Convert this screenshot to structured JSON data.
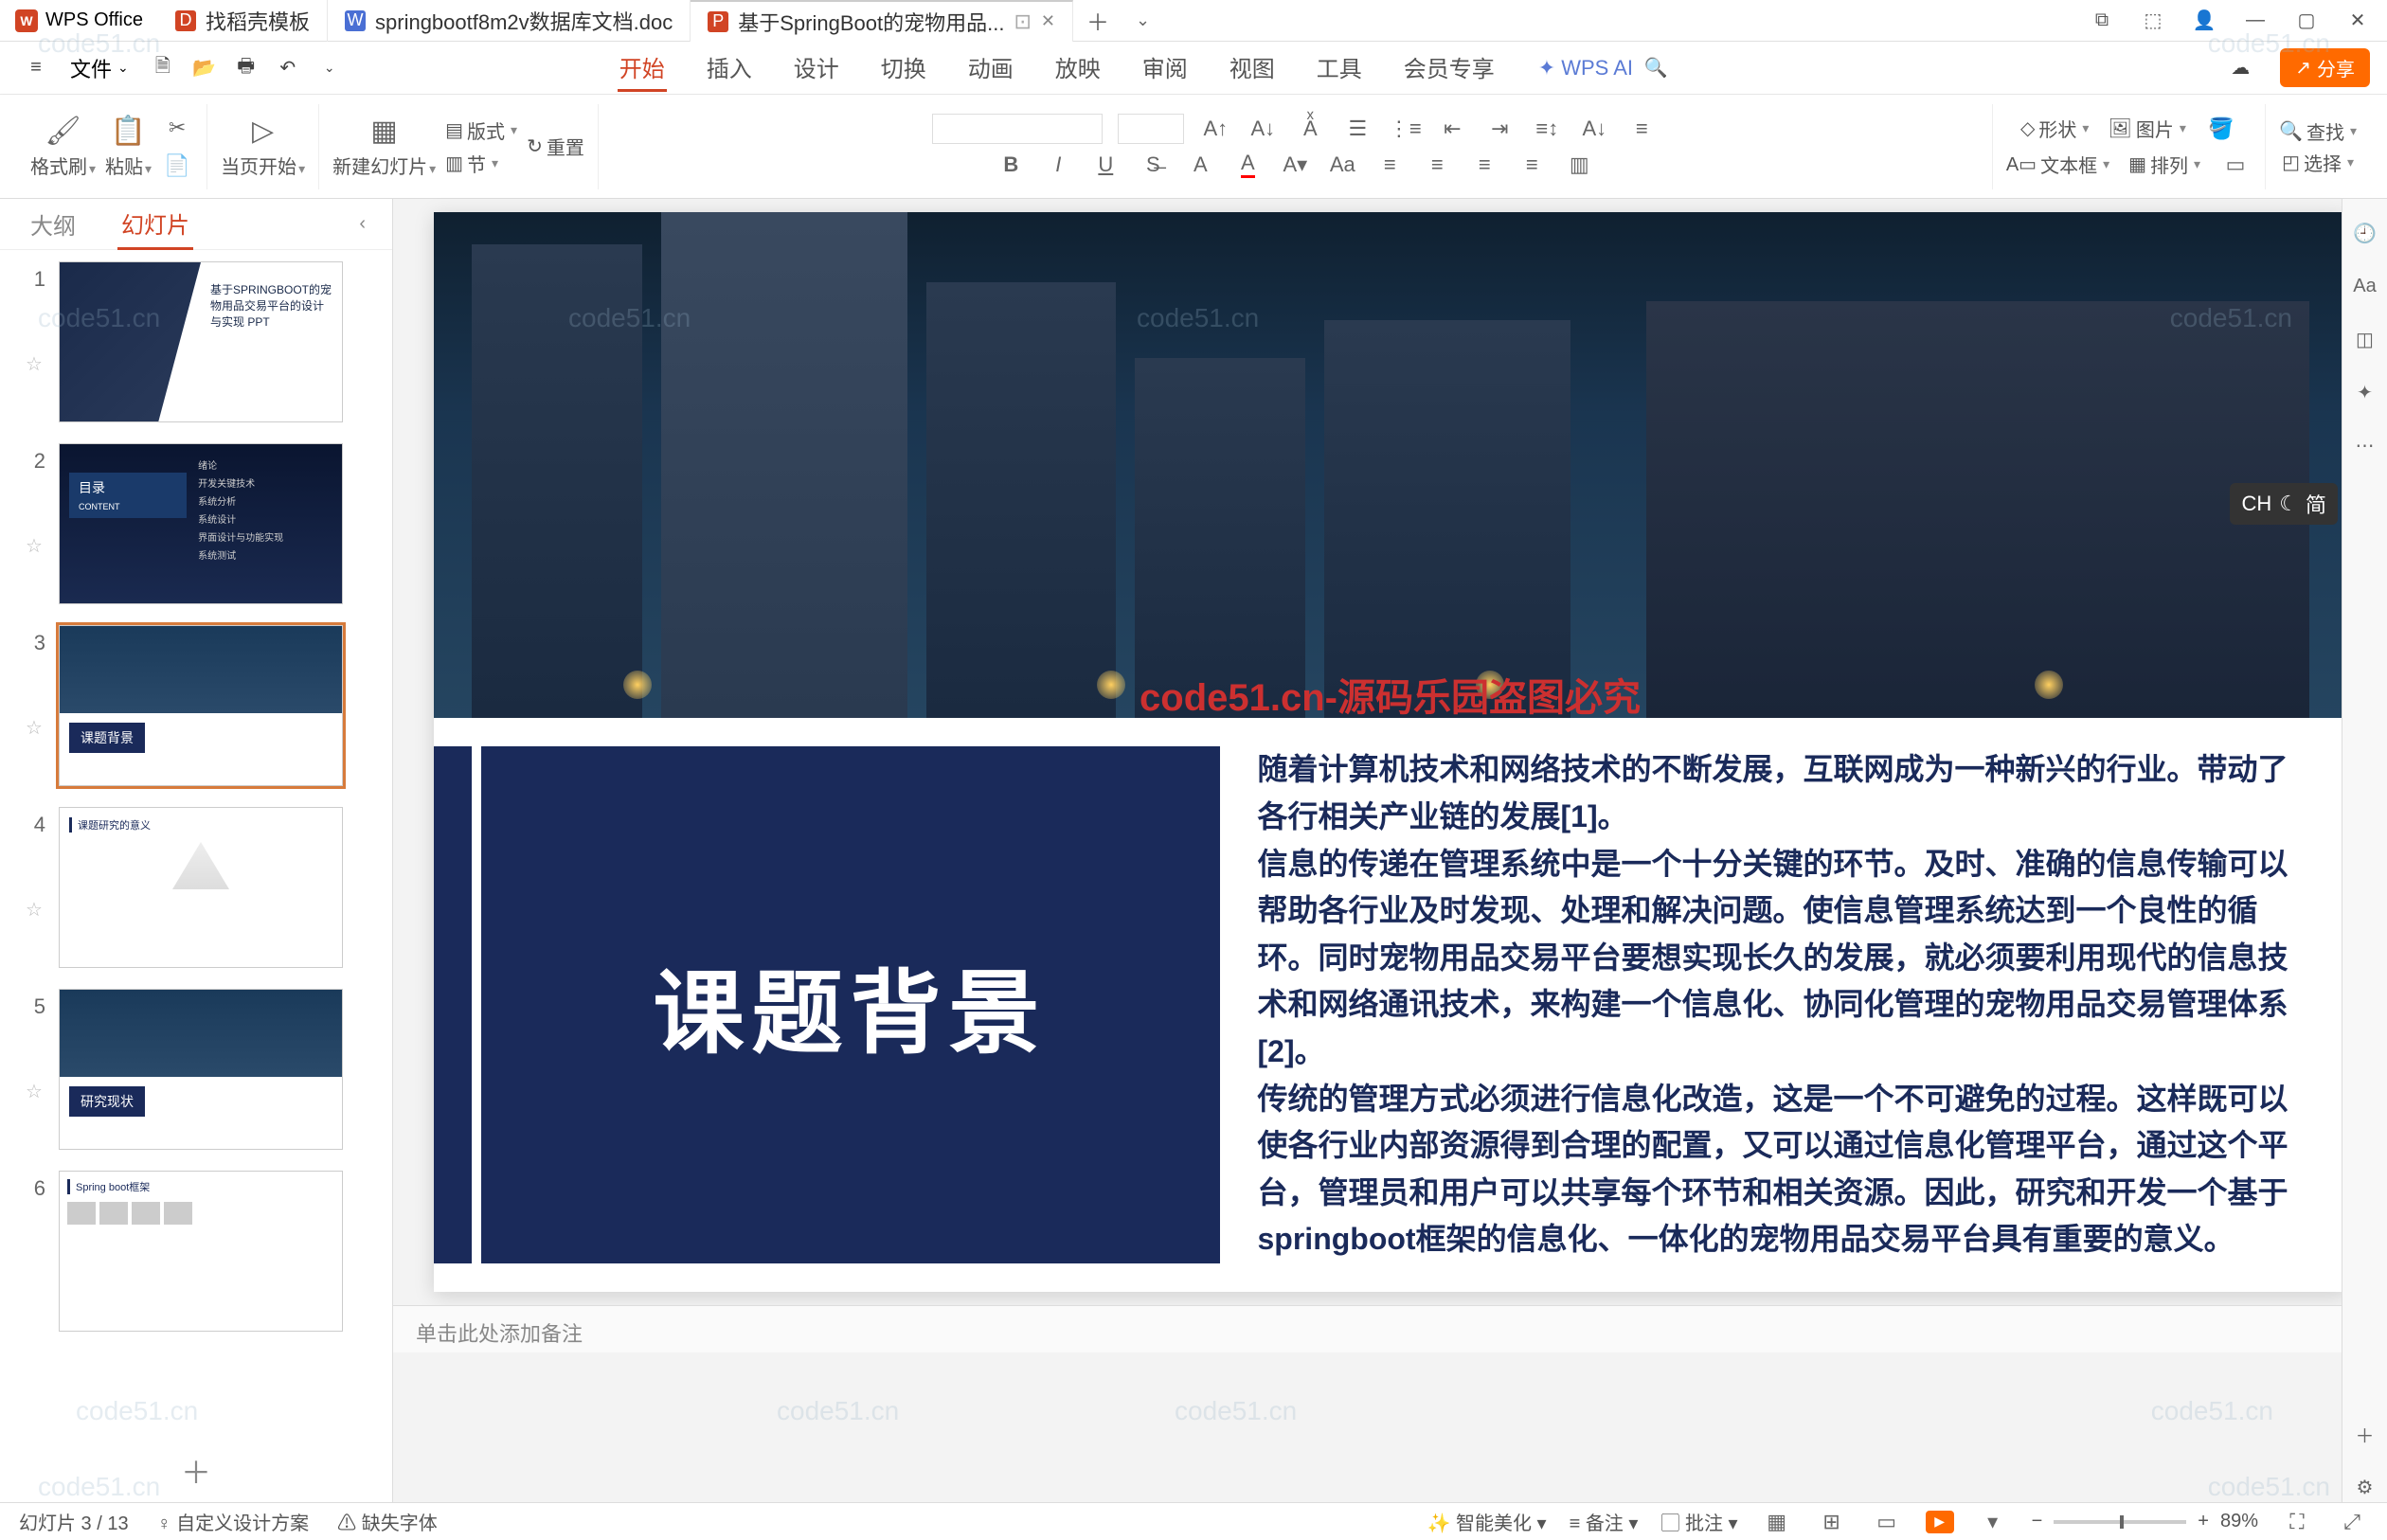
{
  "app": {
    "name": "WPS Office"
  },
  "tabs": [
    {
      "icon": "D",
      "icon_color": "#d14424",
      "label": "找稻壳模板"
    },
    {
      "icon": "W",
      "icon_color": "#4a6fd4",
      "label": "springbootf8m2v数据库文档.doc"
    },
    {
      "icon": "P",
      "icon_color": "#d14424",
      "label": "基于SpringBoot的宠物用品...",
      "active": true
    }
  ],
  "menu": {
    "file": "文件",
    "items": [
      "开始",
      "插入",
      "设计",
      "切换",
      "动画",
      "放映",
      "审阅",
      "视图",
      "工具",
      "会员专享"
    ],
    "active": "开始",
    "ai": "WPS AI",
    "share": "分享"
  },
  "ribbon": {
    "format_painter": "格式刷",
    "paste": "粘贴",
    "from_current": "当页开始",
    "new_slide": "新建幻灯片",
    "layout": "版式",
    "section": "节",
    "reset": "重置",
    "shape": "形状",
    "picture": "图片",
    "find": "查找",
    "textbox": "文本框",
    "arrange": "排列",
    "select": "选择"
  },
  "side": {
    "outline": "大纲",
    "slides": "幻灯片"
  },
  "thumbs": [
    {
      "n": "1",
      "title": "基于SPRINGBOOT的宠物用品交易平台的设计与实现 PPT"
    },
    {
      "n": "2",
      "title": "目录",
      "sub": "CONTENT",
      "items": [
        "绪论",
        "开发关键技术",
        "系统分析",
        "系统设计",
        "界面设计与功能实现",
        "系统测试"
      ]
    },
    {
      "n": "3",
      "title": "课题背景"
    },
    {
      "n": "4",
      "title": "课题研究的意义"
    },
    {
      "n": "5",
      "title": "研究现状"
    },
    {
      "n": "6",
      "title": "Spring boot框架"
    }
  ],
  "slide": {
    "overlay": "code51.cn-源码乐园盗图必究",
    "title": "课题背景",
    "body": "随着计算机技术和网络技术的不断发展，互联网成为一种新兴的行业。带动了各行相关产业链的发展[1]。\n信息的传递在管理系统中是一个十分关键的环节。及时、准确的信息传输可以帮助各行业及时发现、处理和解决问题。使信息管理系统达到一个良性的循环。同时宠物用品交易平台要想实现长久的发展，就必须要利用现代的信息技术和网络通讯技术，来构建一个信息化、协同化管理的宠物用品交易管理体系[2]。\n传统的管理方式必须进行信息化改造，这是一个不可避免的过程。这样既可以使各行业内部资源得到合理的配置，又可以通过信息化管理平台，通过这个平台，管理员和用户可以共享每个环节和相关资源。因此，研究和开发一个基于springboot框架的信息化、一体化的宠物用品交易平台具有重要的意义。"
  },
  "notes_placeholder": "单击此处添加备注",
  "status": {
    "slide_pos": "幻灯片 3 / 13",
    "scheme": "自定义设计方案",
    "font": "缺失字体",
    "beautify": "智能美化",
    "notes": "备注",
    "comments": "批注",
    "zoom": "89%"
  },
  "ime": {
    "lang": "CH",
    "mode": "简"
  },
  "watermark": "code51.cn"
}
